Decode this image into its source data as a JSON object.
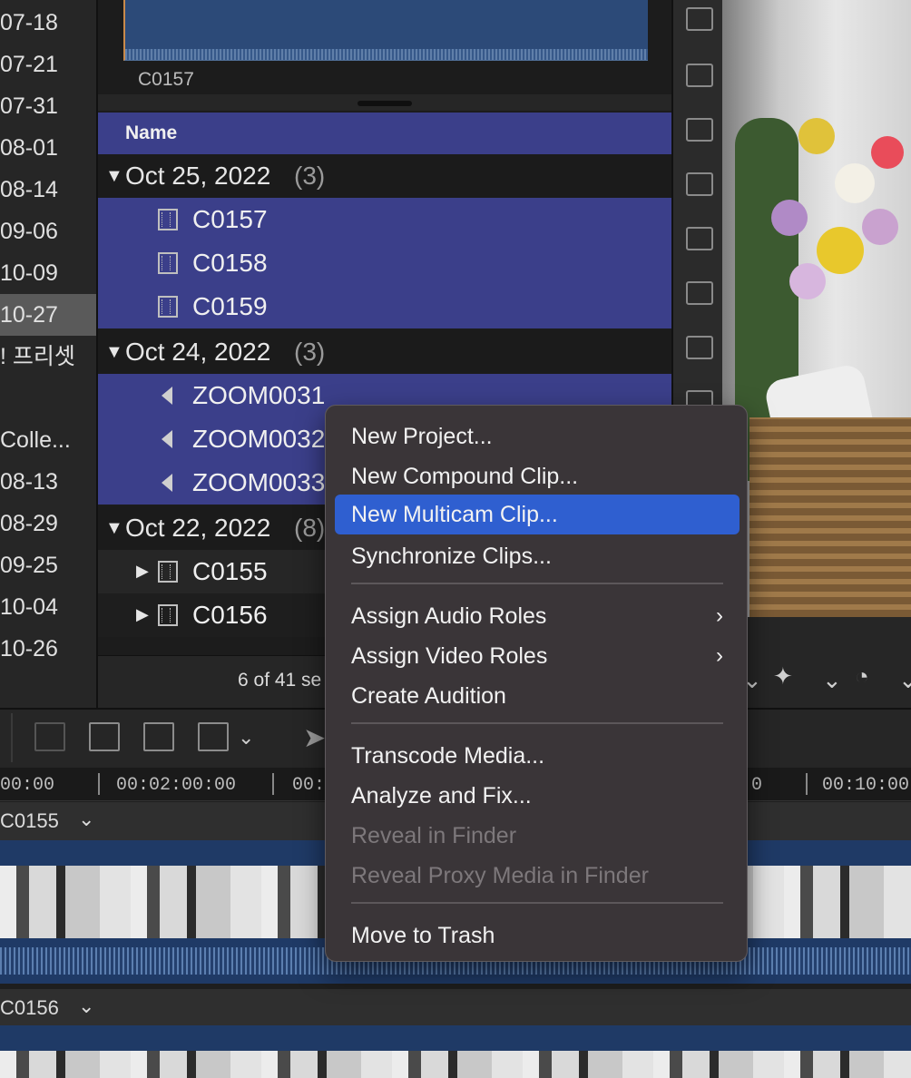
{
  "sidebar": {
    "items": [
      {
        "label": "07-18"
      },
      {
        "label": "07-21"
      },
      {
        "label": "07-31"
      },
      {
        "label": "08-01"
      },
      {
        "label": "08-14"
      },
      {
        "label": "09-06"
      },
      {
        "label": "10-09"
      },
      {
        "label": "10-27",
        "selected": true
      },
      {
        "label": "! 프리셋"
      },
      {
        "label": ""
      },
      {
        "label": "Colle..."
      },
      {
        "label": "08-13"
      },
      {
        "label": "08-29"
      },
      {
        "label": "09-25"
      },
      {
        "label": "10-04"
      },
      {
        "label": "10-26"
      }
    ]
  },
  "browser": {
    "filmstrip_label": "C0157",
    "column_header": "Name",
    "groups": [
      {
        "date": "Oct 25, 2022",
        "count": "(3)",
        "clips": [
          {
            "name": "C0157",
            "type": "video"
          },
          {
            "name": "C0158",
            "type": "video"
          },
          {
            "name": "C0159",
            "type": "video"
          }
        ]
      },
      {
        "date": "Oct 24, 2022",
        "count": "(3)",
        "clips": [
          {
            "name": "ZOOM0031",
            "type": "audio"
          },
          {
            "name": "ZOOM0032",
            "type": "audio"
          },
          {
            "name": "ZOOM0033",
            "type": "audio"
          }
        ]
      },
      {
        "date": "Oct 22, 2022",
        "count": "(8)",
        "clips": [
          {
            "name": "C0155",
            "type": "video"
          },
          {
            "name": "C0156",
            "type": "video"
          }
        ]
      }
    ],
    "selection_info": "6 of 41 se"
  },
  "timeline": {
    "timecodes": [
      "00:00",
      "00:02:00:00",
      "00:",
      "0",
      "00:10:00"
    ],
    "clips": [
      {
        "name": "C0155"
      },
      {
        "name": "C0156"
      }
    ]
  },
  "context_menu": {
    "items": [
      {
        "label": "New Project...",
        "enabled": true
      },
      {
        "label": "New Compound Clip...",
        "enabled": true
      },
      {
        "label": "New Multicam Clip...",
        "enabled": true,
        "highlighted": true
      },
      {
        "label": "Synchronize Clips...",
        "enabled": true
      },
      {
        "label": "Assign Audio Roles",
        "enabled": true,
        "submenu": true
      },
      {
        "label": "Assign Video Roles",
        "enabled": true,
        "submenu": true
      },
      {
        "label": "Create Audition",
        "enabled": true
      },
      {
        "label": "Transcode Media...",
        "enabled": true
      },
      {
        "label": "Analyze and Fix...",
        "enabled": true
      },
      {
        "label": "Reveal in Finder",
        "enabled": false
      },
      {
        "label": "Reveal Proxy Media in Finder",
        "enabled": false
      },
      {
        "label": "Move to Trash",
        "enabled": true
      }
    ],
    "highlight_color": "#2f5fd0"
  },
  "colors": {
    "selection_blue": "#3b3f8a",
    "panel_dark": "#1c1c1c"
  }
}
